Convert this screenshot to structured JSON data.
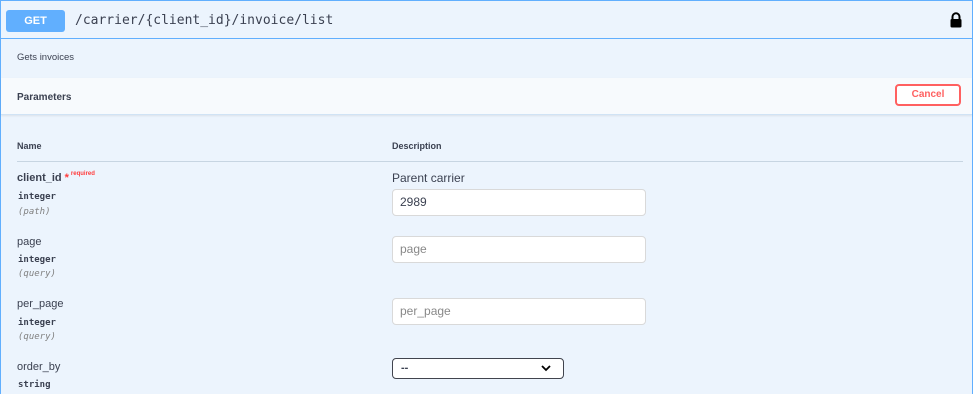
{
  "summary": {
    "method": "GET",
    "path": "/carrier/{client_id}/invoice/list"
  },
  "description": "Gets invoices",
  "parameters_section": {
    "title": "Parameters",
    "cancel_label": "Cancel"
  },
  "columns": {
    "name": "Name",
    "description": "Description"
  },
  "params": [
    {
      "name": "client_id",
      "star": "*",
      "required_label": "required",
      "type": "integer",
      "in": "(path)",
      "description": "Parent carrier",
      "value": "2989"
    },
    {
      "name": "page",
      "type": "integer",
      "in": "(query)",
      "placeholder": "page"
    },
    {
      "name": "per_page",
      "type": "integer",
      "in": "(query)",
      "placeholder": "per_page"
    },
    {
      "name": "order_by",
      "type": "string",
      "selected": "--"
    }
  ],
  "colors": {
    "get_accent": "#61affe",
    "cancel": "#ff6060",
    "required": "#ff3b3b"
  }
}
